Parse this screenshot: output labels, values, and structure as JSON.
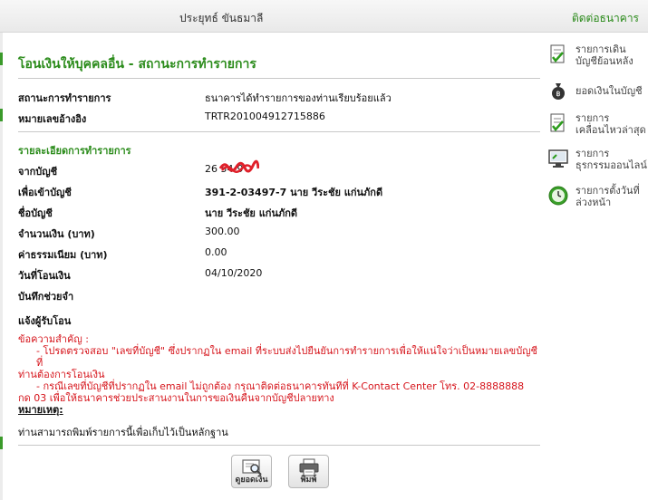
{
  "header": {
    "user_name": "ประยุทธ์ ขันธมาลี",
    "contact_link": "ติดต่อธนาคาร"
  },
  "page": {
    "title": "โอนเงินให้บุคคลอื่น - สถานะการทำรายการ"
  },
  "status": {
    "status_label": "สถานะการทำรายการ",
    "status_value": "ธนาคารได้ทำรายการของท่านเรียบร้อยแล้ว",
    "ref_label": "หมายเลขอ้างอิง",
    "ref_value": "TRTR201004912715886"
  },
  "details": {
    "section_title": "รายละเอียดการทำรายการ",
    "from_label": "จากบัญชี",
    "from_value": "26          54-9",
    "to_label": "เพื่อเข้าบัญชี",
    "to_value": "391-2-03497-7 นาย วีระชัย แก่นภักดี",
    "name_label": "ชื่อบัญชี",
    "name_value": "นาย วีระชัย แก่นภักดี",
    "amount_label": "จำนวนเงิน (บาท)",
    "amount_value": "300.00",
    "fee_label": "ค่าธรรมเนียม (บาท)",
    "fee_value": "0.00",
    "date_label": "วันที่โอนเงิน",
    "date_value": "04/10/2020",
    "memo_label": "บันทึกช่วยจำ",
    "notify_label": "แจ้งผู้รับโอน"
  },
  "important": {
    "title": "ข้อความสำคัญ :",
    "line1": "- โปรดตรวจสอบ \"เลขที่บัญชี\" ซึ่งปรากฏใน email ที่ระบบส่งไปยืนยันการทำรายการเพื่อให้แน่ใจว่าเป็นหมายเลขบัญชีที่",
    "line1b": "ท่านต้องการโอนเงิน",
    "line2": "- กรณีเลขที่บัญชีที่ปรากฏใน email ไม่ถูกต้อง กรุณาติดต่อธนาคารทันทีที่ K-Contact Center โทร. 02-8888888",
    "line2b": "กด 03 เพื่อให้ธนาคารช่วยประสานงานในการขอเงินคืนจากบัญชีปลายทาง"
  },
  "remark": {
    "title": "หมายเหตุ:",
    "text": "ท่านสามารถพิมพ์รายการนี้เพื่อเก็บไว้เป็นหลักฐาน"
  },
  "buttons": {
    "balance": "ดูยอดเงิน",
    "print": "พิมพ์"
  },
  "sidebar": {
    "items": [
      {
        "line1": "รายการเดิน",
        "line2": "บัญชีย้อนหลัง",
        "icon": "checklist-icon"
      },
      {
        "line1": "ยอดเงินในบัญชี",
        "line2": "",
        "icon": "money-bag-icon"
      },
      {
        "line1": "รายการ",
        "line2": "เคลื่อนไหวล่าสุด",
        "icon": "checklist-icon"
      },
      {
        "line1": "รายการ",
        "line2": "ธุรกรรมออนไลน์",
        "icon": "computer-icon"
      },
      {
        "line1": "รายการตั้งวันที่",
        "line2": "ล่วงหน้า",
        "icon": "clock-icon"
      }
    ]
  },
  "colors": {
    "brand_green": "#2c8c1c",
    "warning_red": "#d6151c"
  }
}
